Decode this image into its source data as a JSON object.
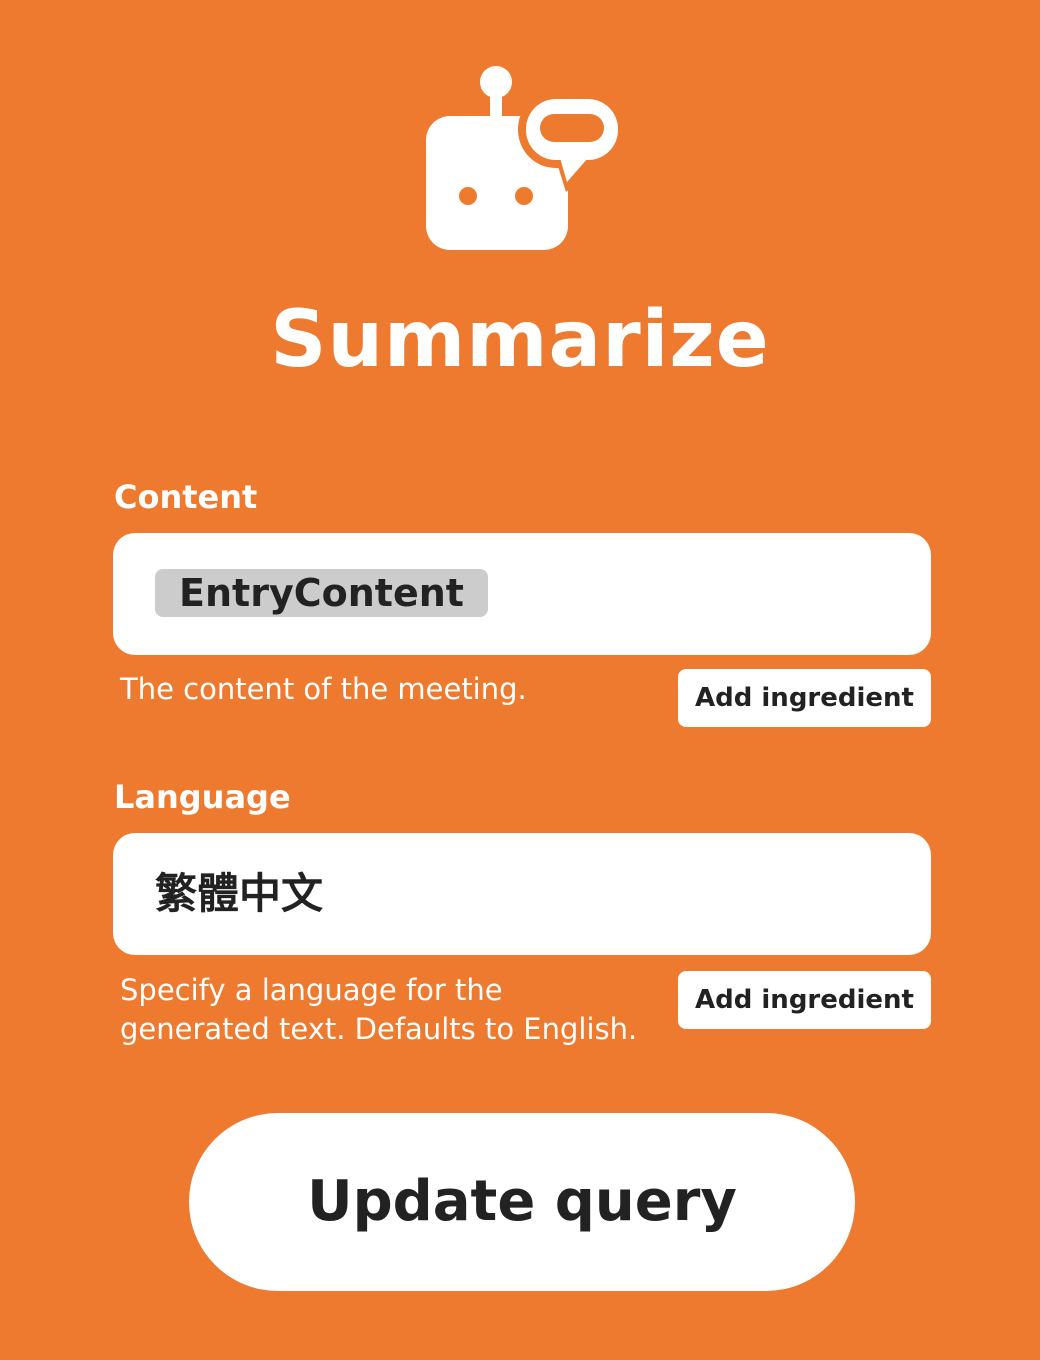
{
  "header": {
    "icon": "robot-speech-bubble-icon",
    "title": "Summarize"
  },
  "fields": [
    {
      "label": "Content",
      "value": "EntryContent",
      "value_kind": "ingredient",
      "help": "The content of the meeting.",
      "add_label": "Add ingredient"
    },
    {
      "label": "Language",
      "value": "繁體中文",
      "value_kind": "text",
      "help": "Specify a language for the generated text. Defaults to English.",
      "add_label": "Add ingredient"
    }
  ],
  "actions": {
    "update_label": "Update query"
  },
  "colors": {
    "background": "#EE7A30",
    "surface": "#FFFFFF",
    "text_dark": "#222222",
    "ingredient_pill": "#CCCCCC"
  }
}
